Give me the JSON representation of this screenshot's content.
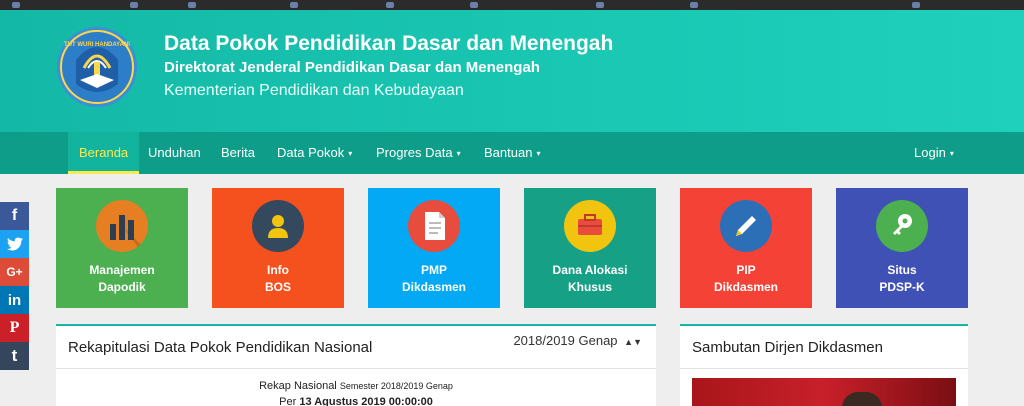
{
  "header": {
    "title": "Data Pokok Pendidikan Dasar dan Menengah",
    "subtitle": "Direktorat Jenderal Pendidikan Dasar dan Menengah",
    "ministry": "Kementerian Pendidikan dan Kebudayaan",
    "logo_text": "TUT WURI HANDAYANI"
  },
  "nav": {
    "items": [
      {
        "label": "Beranda"
      },
      {
        "label": "Unduhan"
      },
      {
        "label": "Berita"
      },
      {
        "label": "Data Pokok",
        "caret": "▾"
      },
      {
        "label": "Progres Data",
        "caret": "▾"
      },
      {
        "label": "Bantuan",
        "caret": "▾"
      }
    ],
    "login": "Login",
    "login_caret": "▾"
  },
  "social": [
    {
      "icon": "facebook-icon",
      "glyph": "f",
      "color": "#3b5998"
    },
    {
      "icon": "twitter-icon",
      "glyph": "🐦",
      "color": "#1da1f2"
    },
    {
      "icon": "google-plus-icon",
      "glyph": "G+",
      "color": "#dd4b39"
    },
    {
      "icon": "linkedin-icon",
      "glyph": "in",
      "color": "#0077b5"
    },
    {
      "icon": "pinterest-icon",
      "glyph": "P",
      "color": "#cb2027"
    },
    {
      "icon": "tumblr-icon",
      "glyph": "t",
      "color": "#35465c"
    }
  ],
  "tiles": [
    {
      "line1": "Manajemen",
      "line2": "Dapodik",
      "color": "#4caf50",
      "icon": "bar-chart-icon"
    },
    {
      "line1": "Info",
      "line2": "BOS",
      "color": "#f4511e",
      "icon": "user-icon"
    },
    {
      "line1": "PMP",
      "line2": "Dikdasmen",
      "color": "#03a9f4",
      "icon": "document-icon"
    },
    {
      "line1": "Dana Alokasi",
      "line2": "Khusus",
      "color": "#16a085",
      "icon": "briefcase-icon"
    },
    {
      "line1": "PIP",
      "line2": "Dikdasmen",
      "color": "#f44336",
      "icon": "pencil-icon"
    },
    {
      "line1": "Situs",
      "line2": "PDSP-K",
      "color": "#3f51b5",
      "icon": "key-icon"
    }
  ],
  "recap": {
    "title": "Rekapitulasi Data Pokok Pendidikan Nasional",
    "semester_select": "2018/2019 Genap",
    "line1_main": "Rekap Nasional",
    "line1_small": "Semester 2018/2019 Genap",
    "line2_prefix": "Per",
    "line2_date": "13 Agustus 2019 00:00:00"
  },
  "sambutan": {
    "title": "Sambutan Dirjen Dikdasmen"
  }
}
